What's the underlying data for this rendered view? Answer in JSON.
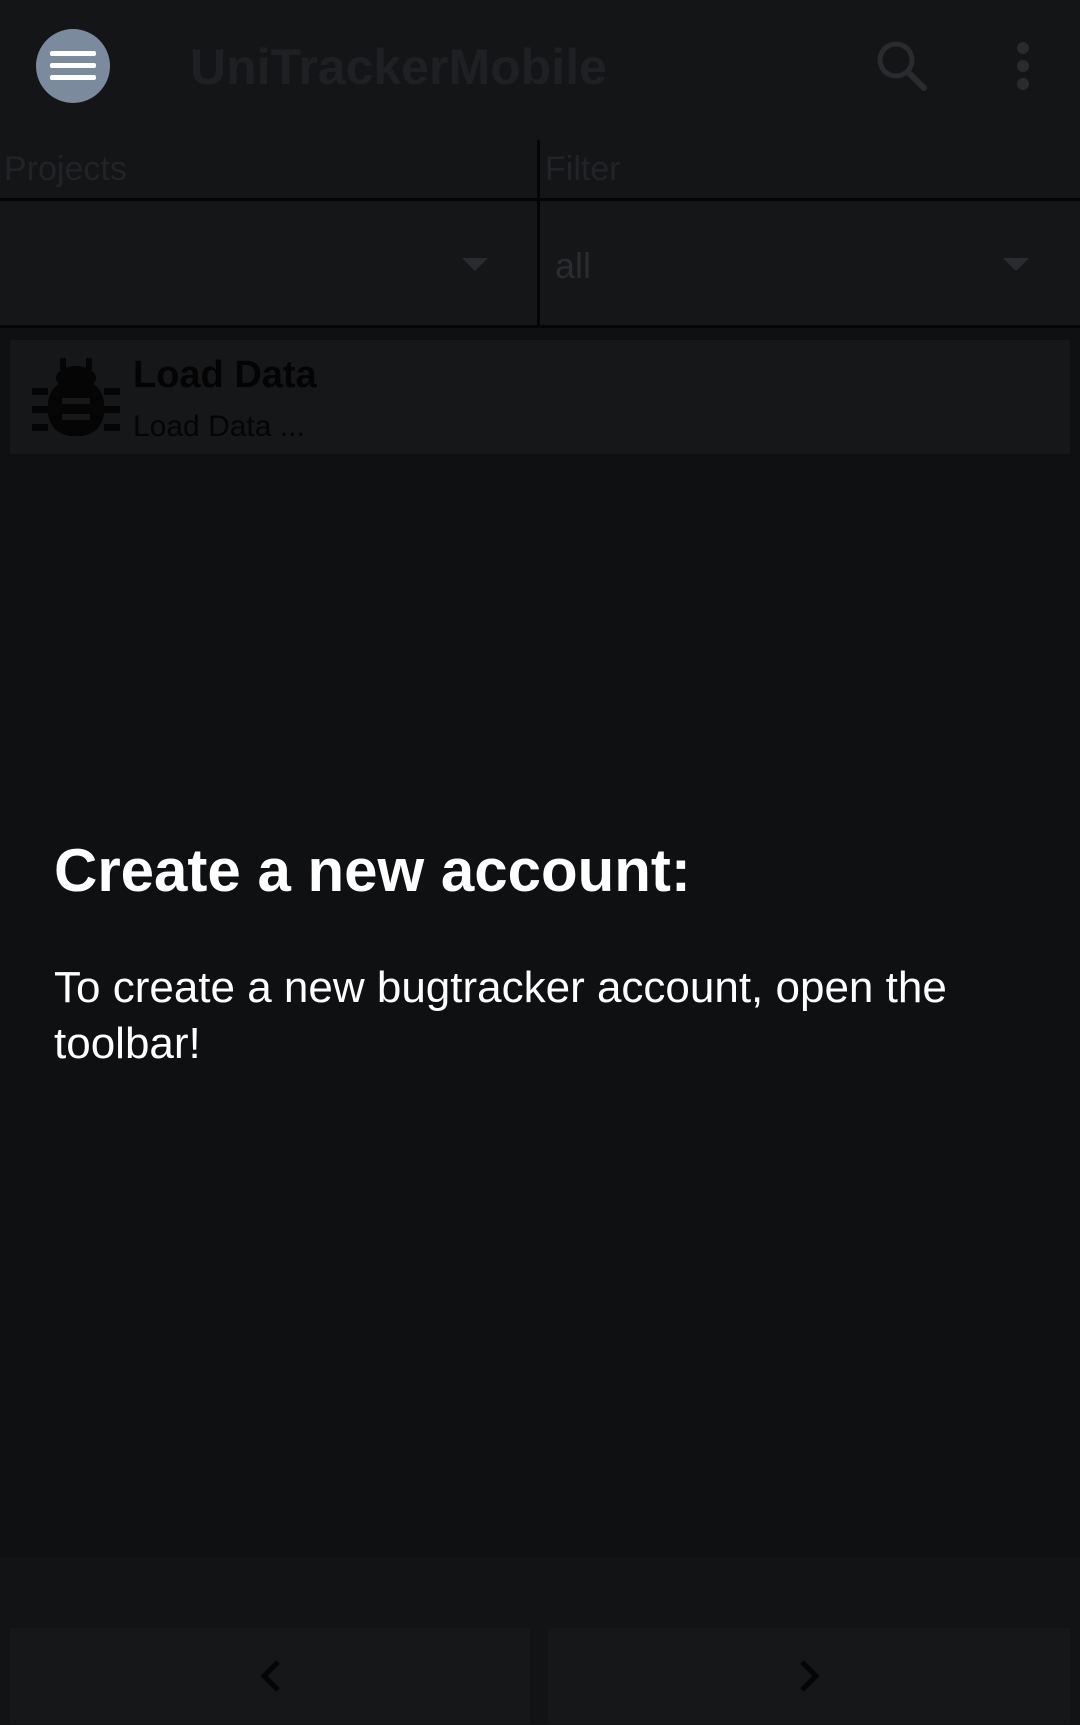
{
  "app": {
    "title": "UniTrackerMobile"
  },
  "spinners": {
    "projects_label": "Projects",
    "filter_label": "Filter",
    "projects_value": "",
    "filter_value": "all"
  },
  "list": {
    "items": [
      {
        "title": "Load Data",
        "subtitle": "Load Data ...",
        "icon": "bug-icon"
      }
    ]
  },
  "overlay": {
    "title": "Create a new account:",
    "text": "To create a new bugtracker account, open the toolbar!"
  },
  "icons": {
    "menu": "menu-icon",
    "search": "search-icon",
    "overflow": "more-vert-icon",
    "prev": "chevron-left-icon",
    "next": "chevron-right-icon"
  },
  "colors": {
    "menu_highlight": "#7b8a9c",
    "overlay_text": "#ffffff"
  }
}
